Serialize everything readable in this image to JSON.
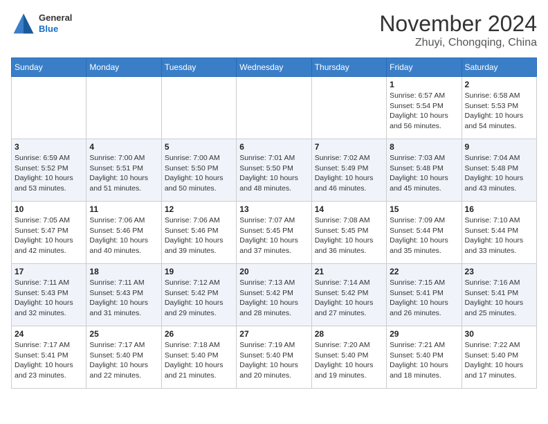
{
  "header": {
    "logo_general": "General",
    "logo_blue": "Blue",
    "month": "November 2024",
    "location": "Zhuyi, Chongqing, China"
  },
  "columns": [
    "Sunday",
    "Monday",
    "Tuesday",
    "Wednesday",
    "Thursday",
    "Friday",
    "Saturday"
  ],
  "weeks": [
    [
      {
        "day": "",
        "info": ""
      },
      {
        "day": "",
        "info": ""
      },
      {
        "day": "",
        "info": ""
      },
      {
        "day": "",
        "info": ""
      },
      {
        "day": "",
        "info": ""
      },
      {
        "day": "1",
        "info": "Sunrise: 6:57 AM\nSunset: 5:54 PM\nDaylight: 10 hours and 56 minutes."
      },
      {
        "day": "2",
        "info": "Sunrise: 6:58 AM\nSunset: 5:53 PM\nDaylight: 10 hours and 54 minutes."
      }
    ],
    [
      {
        "day": "3",
        "info": "Sunrise: 6:59 AM\nSunset: 5:52 PM\nDaylight: 10 hours and 53 minutes."
      },
      {
        "day": "4",
        "info": "Sunrise: 7:00 AM\nSunset: 5:51 PM\nDaylight: 10 hours and 51 minutes."
      },
      {
        "day": "5",
        "info": "Sunrise: 7:00 AM\nSunset: 5:50 PM\nDaylight: 10 hours and 50 minutes."
      },
      {
        "day": "6",
        "info": "Sunrise: 7:01 AM\nSunset: 5:50 PM\nDaylight: 10 hours and 48 minutes."
      },
      {
        "day": "7",
        "info": "Sunrise: 7:02 AM\nSunset: 5:49 PM\nDaylight: 10 hours and 46 minutes."
      },
      {
        "day": "8",
        "info": "Sunrise: 7:03 AM\nSunset: 5:48 PM\nDaylight: 10 hours and 45 minutes."
      },
      {
        "day": "9",
        "info": "Sunrise: 7:04 AM\nSunset: 5:48 PM\nDaylight: 10 hours and 43 minutes."
      }
    ],
    [
      {
        "day": "10",
        "info": "Sunrise: 7:05 AM\nSunset: 5:47 PM\nDaylight: 10 hours and 42 minutes."
      },
      {
        "day": "11",
        "info": "Sunrise: 7:06 AM\nSunset: 5:46 PM\nDaylight: 10 hours and 40 minutes."
      },
      {
        "day": "12",
        "info": "Sunrise: 7:06 AM\nSunset: 5:46 PM\nDaylight: 10 hours and 39 minutes."
      },
      {
        "day": "13",
        "info": "Sunrise: 7:07 AM\nSunset: 5:45 PM\nDaylight: 10 hours and 37 minutes."
      },
      {
        "day": "14",
        "info": "Sunrise: 7:08 AM\nSunset: 5:45 PM\nDaylight: 10 hours and 36 minutes."
      },
      {
        "day": "15",
        "info": "Sunrise: 7:09 AM\nSunset: 5:44 PM\nDaylight: 10 hours and 35 minutes."
      },
      {
        "day": "16",
        "info": "Sunrise: 7:10 AM\nSunset: 5:44 PM\nDaylight: 10 hours and 33 minutes."
      }
    ],
    [
      {
        "day": "17",
        "info": "Sunrise: 7:11 AM\nSunset: 5:43 PM\nDaylight: 10 hours and 32 minutes."
      },
      {
        "day": "18",
        "info": "Sunrise: 7:11 AM\nSunset: 5:43 PM\nDaylight: 10 hours and 31 minutes."
      },
      {
        "day": "19",
        "info": "Sunrise: 7:12 AM\nSunset: 5:42 PM\nDaylight: 10 hours and 29 minutes."
      },
      {
        "day": "20",
        "info": "Sunrise: 7:13 AM\nSunset: 5:42 PM\nDaylight: 10 hours and 28 minutes."
      },
      {
        "day": "21",
        "info": "Sunrise: 7:14 AM\nSunset: 5:42 PM\nDaylight: 10 hours and 27 minutes."
      },
      {
        "day": "22",
        "info": "Sunrise: 7:15 AM\nSunset: 5:41 PM\nDaylight: 10 hours and 26 minutes."
      },
      {
        "day": "23",
        "info": "Sunrise: 7:16 AM\nSunset: 5:41 PM\nDaylight: 10 hours and 25 minutes."
      }
    ],
    [
      {
        "day": "24",
        "info": "Sunrise: 7:17 AM\nSunset: 5:41 PM\nDaylight: 10 hours and 23 minutes."
      },
      {
        "day": "25",
        "info": "Sunrise: 7:17 AM\nSunset: 5:40 PM\nDaylight: 10 hours and 22 minutes."
      },
      {
        "day": "26",
        "info": "Sunrise: 7:18 AM\nSunset: 5:40 PM\nDaylight: 10 hours and 21 minutes."
      },
      {
        "day": "27",
        "info": "Sunrise: 7:19 AM\nSunset: 5:40 PM\nDaylight: 10 hours and 20 minutes."
      },
      {
        "day": "28",
        "info": "Sunrise: 7:20 AM\nSunset: 5:40 PM\nDaylight: 10 hours and 19 minutes."
      },
      {
        "day": "29",
        "info": "Sunrise: 7:21 AM\nSunset: 5:40 PM\nDaylight: 10 hours and 18 minutes."
      },
      {
        "day": "30",
        "info": "Sunrise: 7:22 AM\nSunset: 5:40 PM\nDaylight: 10 hours and 17 minutes."
      }
    ]
  ]
}
